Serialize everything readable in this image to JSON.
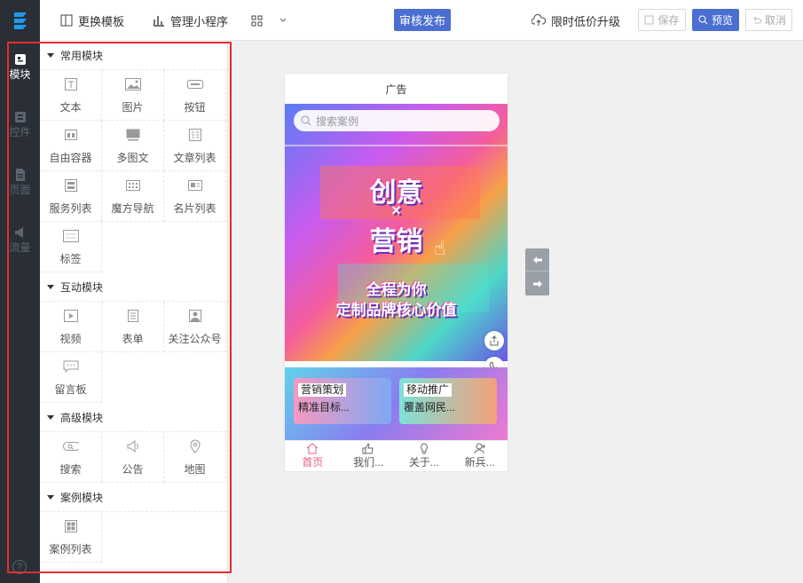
{
  "toolbar": {
    "change_template": "更换模板",
    "manage_mini": "管理小程序",
    "publish": "审核发布",
    "upgrade": "限时低价升级",
    "save": "保存",
    "preview": "预览",
    "cancel": "取消"
  },
  "rail": [
    {
      "label": "模块",
      "icon": "module-icon",
      "active": true
    },
    {
      "label": "控件",
      "icon": "widget-icon",
      "active": false
    },
    {
      "label": "页面",
      "icon": "page-icon",
      "active": false
    },
    {
      "label": "流量",
      "icon": "traffic-icon",
      "active": false
    }
  ],
  "sections": [
    {
      "title": "常用模块",
      "items": [
        {
          "label": "文本",
          "icon": "text-icon"
        },
        {
          "label": "图片",
          "icon": "image-icon"
        },
        {
          "label": "按钮",
          "icon": "button-icon"
        },
        {
          "label": "自由容器",
          "icon": "container-icon"
        },
        {
          "label": "多图文",
          "icon": "multi-image-icon"
        },
        {
          "label": "文章列表",
          "icon": "article-list-icon"
        },
        {
          "label": "服务列表",
          "icon": "service-list-icon"
        },
        {
          "label": "魔方导航",
          "icon": "cube-nav-icon"
        },
        {
          "label": "名片列表",
          "icon": "card-list-icon"
        },
        {
          "label": "标签",
          "icon": "tag-icon"
        }
      ]
    },
    {
      "title": "互动模块",
      "items": [
        {
          "label": "视频",
          "icon": "video-icon"
        },
        {
          "label": "表单",
          "icon": "form-icon"
        },
        {
          "label": "关注公众号",
          "icon": "follow-icon"
        },
        {
          "label": "留言板",
          "icon": "message-icon"
        }
      ]
    },
    {
      "title": "高级模块",
      "items": [
        {
          "label": "搜索",
          "icon": "search-icon"
        },
        {
          "label": "公告",
          "icon": "notice-icon"
        },
        {
          "label": "地图",
          "icon": "map-icon"
        }
      ]
    },
    {
      "title": "案例模块",
      "items": [
        {
          "label": "案例列表",
          "icon": "case-list-icon"
        }
      ]
    }
  ],
  "phone": {
    "title": "广告",
    "search_placeholder": "搜索案例",
    "banner_line1": "创意",
    "banner_x": "×",
    "banner_line2": "营销",
    "banner_sub1": "全程为你",
    "banner_sub2": "定制品牌核心价值",
    "card1_title": "营销策划",
    "card1_desc": "精准目标...",
    "card2_title": "移动推广",
    "card2_desc": "覆盖网民...",
    "tabs": [
      {
        "label": "首页",
        "icon": "home-icon",
        "active": true
      },
      {
        "label": "我们...",
        "icon": "thumb-icon",
        "active": false
      },
      {
        "label": "关于...",
        "icon": "bulb-icon",
        "active": false
      },
      {
        "label": "新兵...",
        "icon": "user-add-icon",
        "active": false
      }
    ]
  },
  "colors": {
    "accent": "#4a6fd1",
    "highlight": "#e52d2d",
    "rail": "#2a2f37"
  }
}
